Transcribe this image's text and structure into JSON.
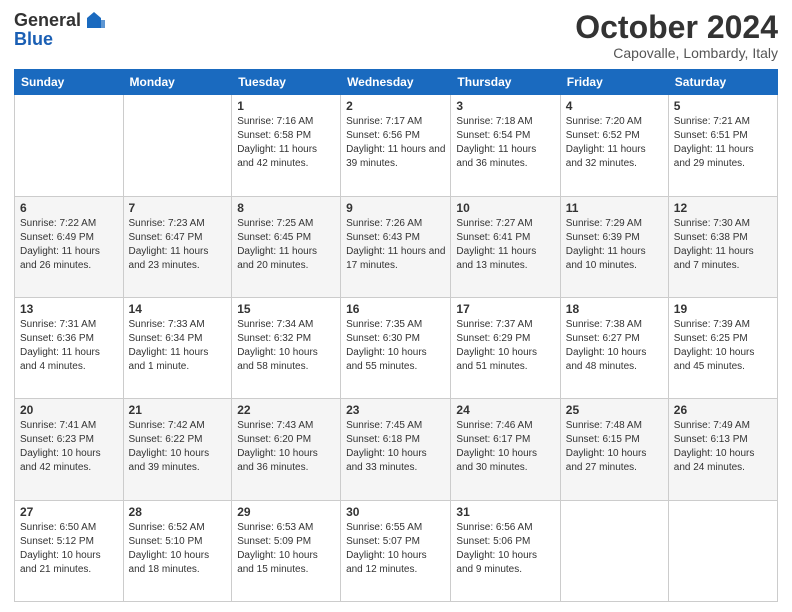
{
  "header": {
    "logo_line1": "General",
    "logo_line2": "Blue",
    "month": "October 2024",
    "location": "Capovalle, Lombardy, Italy"
  },
  "days_of_week": [
    "Sunday",
    "Monday",
    "Tuesday",
    "Wednesday",
    "Thursday",
    "Friday",
    "Saturday"
  ],
  "weeks": [
    [
      {
        "day": "",
        "info": ""
      },
      {
        "day": "",
        "info": ""
      },
      {
        "day": "1",
        "info": "Sunrise: 7:16 AM\nSunset: 6:58 PM\nDaylight: 11 hours and 42 minutes."
      },
      {
        "day": "2",
        "info": "Sunrise: 7:17 AM\nSunset: 6:56 PM\nDaylight: 11 hours and 39 minutes."
      },
      {
        "day": "3",
        "info": "Sunrise: 7:18 AM\nSunset: 6:54 PM\nDaylight: 11 hours and 36 minutes."
      },
      {
        "day": "4",
        "info": "Sunrise: 7:20 AM\nSunset: 6:52 PM\nDaylight: 11 hours and 32 minutes."
      },
      {
        "day": "5",
        "info": "Sunrise: 7:21 AM\nSunset: 6:51 PM\nDaylight: 11 hours and 29 minutes."
      }
    ],
    [
      {
        "day": "6",
        "info": "Sunrise: 7:22 AM\nSunset: 6:49 PM\nDaylight: 11 hours and 26 minutes."
      },
      {
        "day": "7",
        "info": "Sunrise: 7:23 AM\nSunset: 6:47 PM\nDaylight: 11 hours and 23 minutes."
      },
      {
        "day": "8",
        "info": "Sunrise: 7:25 AM\nSunset: 6:45 PM\nDaylight: 11 hours and 20 minutes."
      },
      {
        "day": "9",
        "info": "Sunrise: 7:26 AM\nSunset: 6:43 PM\nDaylight: 11 hours and 17 minutes."
      },
      {
        "day": "10",
        "info": "Sunrise: 7:27 AM\nSunset: 6:41 PM\nDaylight: 11 hours and 13 minutes."
      },
      {
        "day": "11",
        "info": "Sunrise: 7:29 AM\nSunset: 6:39 PM\nDaylight: 11 hours and 10 minutes."
      },
      {
        "day": "12",
        "info": "Sunrise: 7:30 AM\nSunset: 6:38 PM\nDaylight: 11 hours and 7 minutes."
      }
    ],
    [
      {
        "day": "13",
        "info": "Sunrise: 7:31 AM\nSunset: 6:36 PM\nDaylight: 11 hours and 4 minutes."
      },
      {
        "day": "14",
        "info": "Sunrise: 7:33 AM\nSunset: 6:34 PM\nDaylight: 11 hours and 1 minute."
      },
      {
        "day": "15",
        "info": "Sunrise: 7:34 AM\nSunset: 6:32 PM\nDaylight: 10 hours and 58 minutes."
      },
      {
        "day": "16",
        "info": "Sunrise: 7:35 AM\nSunset: 6:30 PM\nDaylight: 10 hours and 55 minutes."
      },
      {
        "day": "17",
        "info": "Sunrise: 7:37 AM\nSunset: 6:29 PM\nDaylight: 10 hours and 51 minutes."
      },
      {
        "day": "18",
        "info": "Sunrise: 7:38 AM\nSunset: 6:27 PM\nDaylight: 10 hours and 48 minutes."
      },
      {
        "day": "19",
        "info": "Sunrise: 7:39 AM\nSunset: 6:25 PM\nDaylight: 10 hours and 45 minutes."
      }
    ],
    [
      {
        "day": "20",
        "info": "Sunrise: 7:41 AM\nSunset: 6:23 PM\nDaylight: 10 hours and 42 minutes."
      },
      {
        "day": "21",
        "info": "Sunrise: 7:42 AM\nSunset: 6:22 PM\nDaylight: 10 hours and 39 minutes."
      },
      {
        "day": "22",
        "info": "Sunrise: 7:43 AM\nSunset: 6:20 PM\nDaylight: 10 hours and 36 minutes."
      },
      {
        "day": "23",
        "info": "Sunrise: 7:45 AM\nSunset: 6:18 PM\nDaylight: 10 hours and 33 minutes."
      },
      {
        "day": "24",
        "info": "Sunrise: 7:46 AM\nSunset: 6:17 PM\nDaylight: 10 hours and 30 minutes."
      },
      {
        "day": "25",
        "info": "Sunrise: 7:48 AM\nSunset: 6:15 PM\nDaylight: 10 hours and 27 minutes."
      },
      {
        "day": "26",
        "info": "Sunrise: 7:49 AM\nSunset: 6:13 PM\nDaylight: 10 hours and 24 minutes."
      }
    ],
    [
      {
        "day": "27",
        "info": "Sunrise: 6:50 AM\nSunset: 5:12 PM\nDaylight: 10 hours and 21 minutes."
      },
      {
        "day": "28",
        "info": "Sunrise: 6:52 AM\nSunset: 5:10 PM\nDaylight: 10 hours and 18 minutes."
      },
      {
        "day": "29",
        "info": "Sunrise: 6:53 AM\nSunset: 5:09 PM\nDaylight: 10 hours and 15 minutes."
      },
      {
        "day": "30",
        "info": "Sunrise: 6:55 AM\nSunset: 5:07 PM\nDaylight: 10 hours and 12 minutes."
      },
      {
        "day": "31",
        "info": "Sunrise: 6:56 AM\nSunset: 5:06 PM\nDaylight: 10 hours and 9 minutes."
      },
      {
        "day": "",
        "info": ""
      },
      {
        "day": "",
        "info": ""
      }
    ]
  ]
}
